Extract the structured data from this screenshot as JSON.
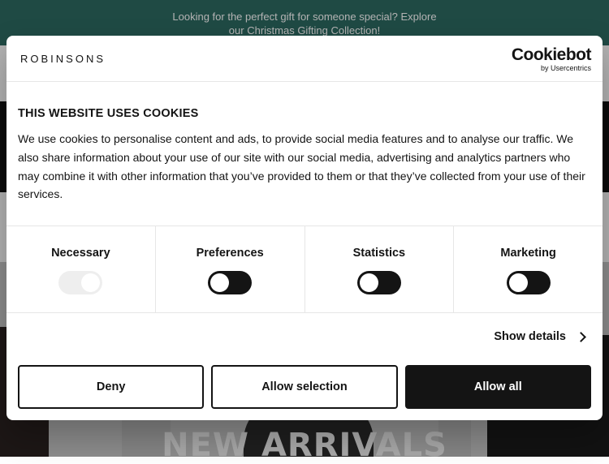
{
  "promo_bar": {
    "line1": "Looking for the perfect gift for someone special? Explore",
    "line2": "our Christmas Gifting Collection!"
  },
  "hero": {
    "title": "NEW ARRIVALS"
  },
  "cookie_dialog": {
    "brand": "ROBINSONS",
    "provider": {
      "name": "Cookiebot",
      "sub": "by Usercentrics"
    },
    "title": "THIS WEBSITE USES COOKIES",
    "body": "We use cookies to personalise content and ads, to provide social media features and to analyse our traffic. We also share information about your use of our site with our social media, advertising and analytics partners who may combine it with other information that you’ve provided to them or that they’ve collected from your use of their services.",
    "categories": [
      {
        "label": "Necessary",
        "enabled": true,
        "locked": true
      },
      {
        "label": "Preferences",
        "enabled": false,
        "locked": false
      },
      {
        "label": "Statistics",
        "enabled": false,
        "locked": false
      },
      {
        "label": "Marketing",
        "enabled": false,
        "locked": false
      }
    ],
    "show_details": "Show details",
    "buttons": {
      "deny": "Deny",
      "allow_selection": "Allow selection",
      "allow_all": "Allow all"
    }
  },
  "colors": {
    "promo_bg": "#2d6a62",
    "text": "#141414",
    "primary_button": "#141414"
  }
}
